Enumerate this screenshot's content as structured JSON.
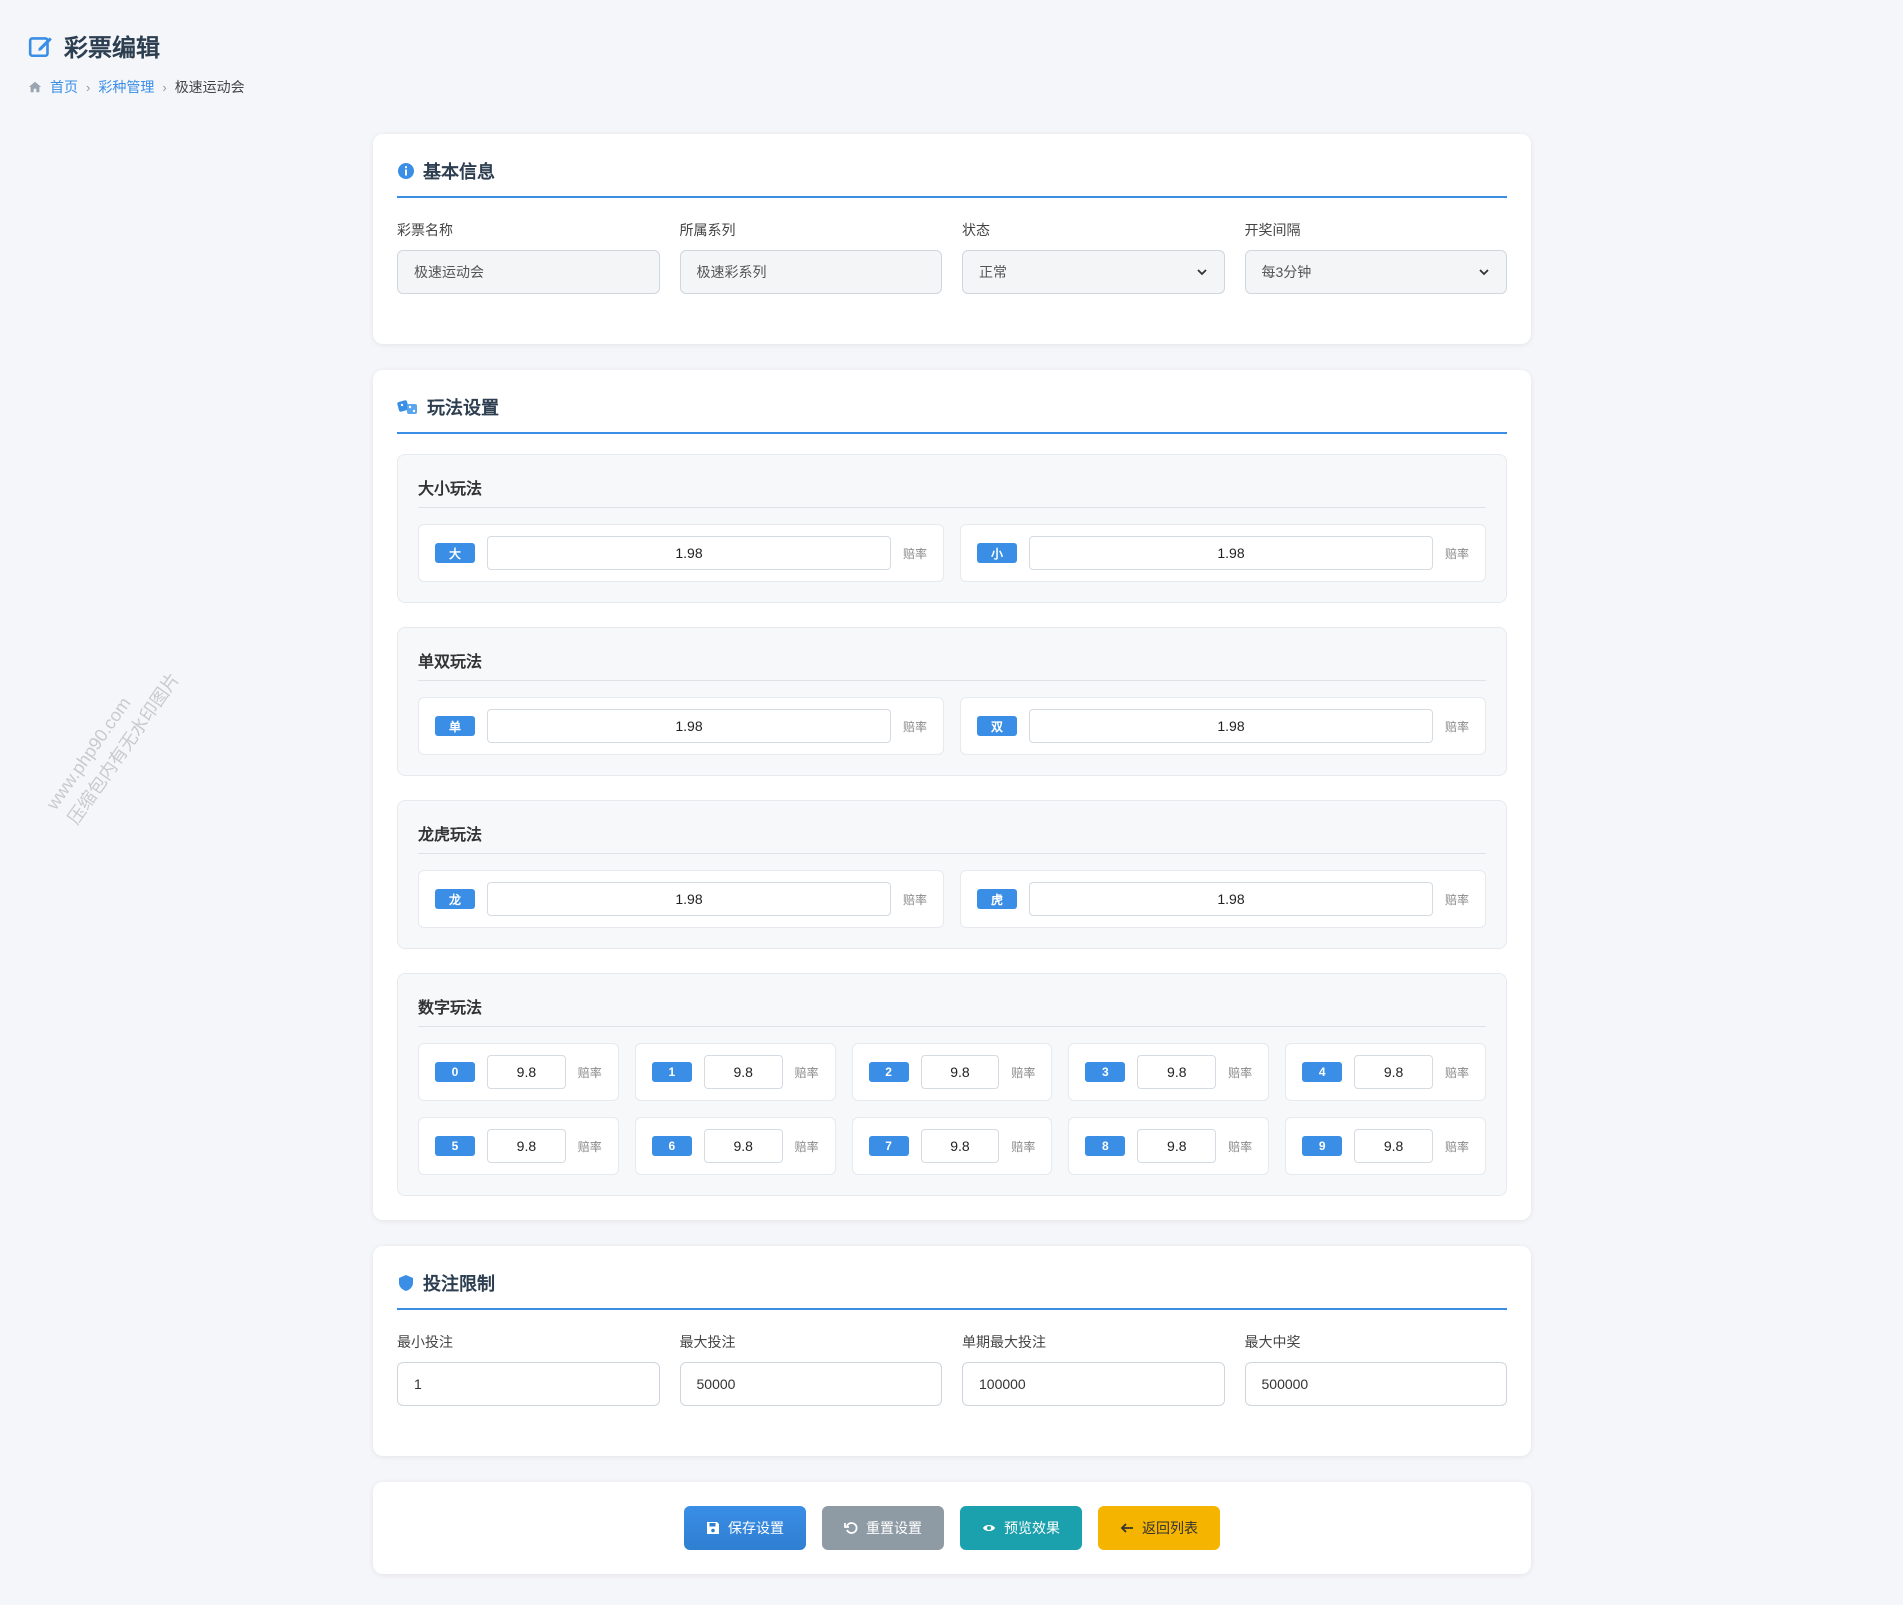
{
  "page": {
    "title": "彩票编辑",
    "breadcrumb": [
      "首页",
      "彩种管理",
      "极速运动会"
    ]
  },
  "basic": {
    "title": "基本信息",
    "fields": [
      {
        "label": "彩票名称",
        "value": "极速运动会",
        "type": "readonly"
      },
      {
        "label": "所属系列",
        "value": "极速彩系列",
        "type": "readonly"
      },
      {
        "label": "状态",
        "value": "正常",
        "type": "select"
      },
      {
        "label": "开奖间隔",
        "value": "每3分钟",
        "type": "select"
      }
    ]
  },
  "play": {
    "title": "玩法设置",
    "unit": "赔率",
    "groups": [
      {
        "title": "大小玩法",
        "items": [
          {
            "name": "大",
            "odds": "1.98"
          },
          {
            "name": "小",
            "odds": "1.98"
          }
        ]
      },
      {
        "title": "单双玩法",
        "items": [
          {
            "name": "单",
            "odds": "1.98"
          },
          {
            "name": "双",
            "odds": "1.98"
          }
        ]
      },
      {
        "title": "龙虎玩法",
        "items": [
          {
            "name": "龙",
            "odds": "1.98"
          },
          {
            "name": "虎",
            "odds": "1.98"
          }
        ]
      }
    ],
    "number_group": {
      "title": "数字玩法",
      "items": [
        {
          "name": "0",
          "odds": "9.8"
        },
        {
          "name": "1",
          "odds": "9.8"
        },
        {
          "name": "2",
          "odds": "9.8"
        },
        {
          "name": "3",
          "odds": "9.8"
        },
        {
          "name": "4",
          "odds": "9.8"
        },
        {
          "name": "5",
          "odds": "9.8"
        },
        {
          "name": "6",
          "odds": "9.8"
        },
        {
          "name": "7",
          "odds": "9.8"
        },
        {
          "name": "8",
          "odds": "9.8"
        },
        {
          "name": "9",
          "odds": "9.8"
        }
      ]
    }
  },
  "limit": {
    "title": "投注限制",
    "fields": [
      {
        "label": "最小投注",
        "value": "1"
      },
      {
        "label": "最大投注",
        "value": "50000"
      },
      {
        "label": "单期最大投注",
        "value": "100000"
      },
      {
        "label": "最大中奖",
        "value": "500000"
      }
    ]
  },
  "actions": {
    "save": "保存设置",
    "reset": "重置设置",
    "preview": "预览效果",
    "back": "返回列表"
  },
  "watermark": [
    "www.php90.com",
    "压缩包内有无水印图片"
  ],
  "colors": {
    "accent": "#3a8ee6",
    "preview": "#1ba0ad",
    "back": "#f5b400",
    "reset": "#8e9aa4"
  }
}
